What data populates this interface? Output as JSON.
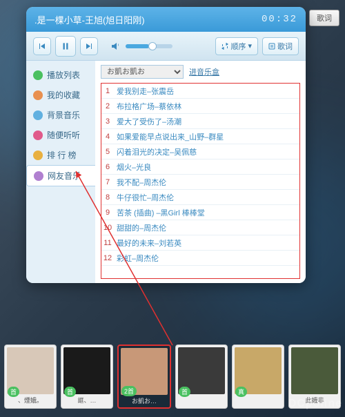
{
  "titlebar": {
    "song": ".是一棵小草-王旭(旭日阳刚)",
    "time": "00:32"
  },
  "toolbar": {
    "order": "顺序",
    "lyric": "歌词"
  },
  "sidebar": {
    "items": [
      {
        "label": "播放列表"
      },
      {
        "label": "我的收藏"
      },
      {
        "label": "背景音乐"
      },
      {
        "label": "随便听听"
      },
      {
        "label": "排 行 榜"
      },
      {
        "label": "网友音乐"
      }
    ]
  },
  "filter": {
    "selected": "お凱お凱お",
    "link": "进音乐盒"
  },
  "songs": [
    {
      "n": "1",
      "t": "爱我别走–张震岳"
    },
    {
      "n": "2",
      "t": "布拉格广场–蔡依林"
    },
    {
      "n": "3",
      "t": "爱大了受伤了–汤潮"
    },
    {
      "n": "4",
      "t": "如果爱能早点说出来_山野–群星"
    },
    {
      "n": "5",
      "t": "闪着泪光的决定–吴佩慈"
    },
    {
      "n": "6",
      "t": "烟火–光良"
    },
    {
      "n": "7",
      "t": "我不配–周杰伦"
    },
    {
      "n": "8",
      "t": "牛仔很忙–周杰伦"
    },
    {
      "n": "9",
      "t": "苦茶 (插曲) –黑Girl 棒棒堂"
    },
    {
      "n": "10",
      "t": "甜甜的–周杰伦"
    },
    {
      "n": "11",
      "t": "最好的未来–刘若英"
    },
    {
      "n": "12",
      "t": "彩虹–周杰伦"
    }
  ],
  "top_btn": "歌词",
  "dock": [
    {
      "name": "、煙娥。",
      "badge": "首",
      "color": "#d8c8b8"
    },
    {
      "name": "誆、…",
      "badge": "首",
      "color": "#1a1a1a"
    },
    {
      "name": "お凱お…",
      "badge": "2首",
      "color": "#c89878"
    },
    {
      "name": "",
      "badge": "首",
      "color": "#3a3a3a"
    },
    {
      "name": "",
      "badge": "真",
      "color": "#c8a868"
    },
    {
      "name": "此娥非",
      "badge": "",
      "color": "#4a5a3a"
    }
  ],
  "watermark": "DCpoline"
}
